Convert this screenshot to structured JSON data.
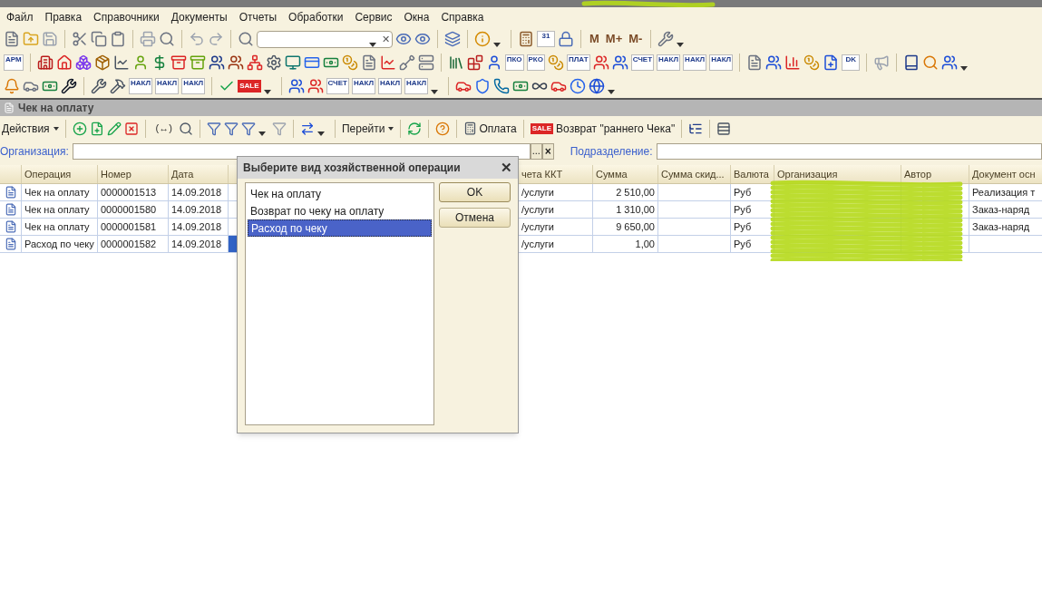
{
  "menu": [
    "Файл",
    "Правка",
    "Справочники",
    "Документы",
    "Отчеты",
    "Обработки",
    "Сервис",
    "Окна",
    "Справка"
  ],
  "toolbars": [
    {
      "items": [
        {
          "kind": "icon"
        },
        {
          "kind": "icon"
        },
        {
          "kind": "icon"
        },
        {
          "kind": "sep"
        },
        {
          "kind": "icon"
        },
        {
          "kind": "icon"
        },
        {
          "kind": "icon"
        },
        {
          "kind": "sep"
        },
        {
          "kind": "icon"
        },
        {
          "kind": "icon"
        },
        {
          "kind": "sep"
        },
        {
          "kind": "icon"
        },
        {
          "kind": "icon"
        },
        {
          "kind": "sep"
        },
        {
          "kind": "icon"
        },
        {
          "kind": "search",
          "clear": "✕"
        },
        {
          "kind": "icon"
        },
        {
          "kind": "icon"
        },
        {
          "kind": "sep"
        },
        {
          "kind": "icon"
        },
        {
          "kind": "sep"
        },
        {
          "kind": "icon"
        },
        {
          "kind": "drop"
        },
        {
          "kind": "sep"
        },
        {
          "kind": "icon"
        },
        {
          "kind": "tag",
          "label": "31"
        },
        {
          "kind": "icon"
        },
        {
          "kind": "sep"
        },
        {
          "kind": "letter",
          "label": "M"
        },
        {
          "kind": "letter",
          "label": "M+"
        },
        {
          "kind": "letter",
          "label": "M-"
        },
        {
          "kind": "sep"
        },
        {
          "kind": "icon"
        },
        {
          "kind": "drop"
        }
      ]
    },
    {
      "items": [
        {
          "kind": "tag",
          "label": "АРМ"
        },
        {
          "kind": "sep"
        },
        {
          "kind": "icon"
        },
        {
          "kind": "icon"
        },
        {
          "kind": "icon"
        },
        {
          "kind": "icon"
        },
        {
          "kind": "icon"
        },
        {
          "kind": "icon"
        },
        {
          "kind": "icon"
        },
        {
          "kind": "icon"
        },
        {
          "kind": "icon"
        },
        {
          "kind": "icon"
        },
        {
          "kind": "icon"
        },
        {
          "kind": "icon"
        },
        {
          "kind": "icon"
        },
        {
          "kind": "icon"
        },
        {
          "kind": "icon"
        },
        {
          "kind": "icon"
        },
        {
          "kind": "icon"
        },
        {
          "kind": "icon"
        },
        {
          "kind": "icon"
        },
        {
          "kind": "icon"
        },
        {
          "kind": "icon"
        },
        {
          "kind": "sep"
        },
        {
          "kind": "icon"
        },
        {
          "kind": "icon"
        },
        {
          "kind": "icon"
        },
        {
          "kind": "tag",
          "label": "ПКО"
        },
        {
          "kind": "tag",
          "label": "РКО"
        },
        {
          "kind": "icon"
        },
        {
          "kind": "tag",
          "label": "ПЛАТ"
        },
        {
          "kind": "icon"
        },
        {
          "kind": "icon"
        },
        {
          "kind": "tag",
          "label": "СЧЕТ"
        },
        {
          "kind": "tag",
          "label": "НАКЛ"
        },
        {
          "kind": "tag",
          "label": "НАКЛ"
        },
        {
          "kind": "tag",
          "label": "НАКЛ"
        },
        {
          "kind": "sep"
        },
        {
          "kind": "icon"
        },
        {
          "kind": "icon"
        },
        {
          "kind": "icon"
        },
        {
          "kind": "icon"
        },
        {
          "kind": "icon"
        },
        {
          "kind": "tag",
          "label": "DK"
        },
        {
          "kind": "sep"
        },
        {
          "kind": "icon"
        },
        {
          "kind": "sep"
        },
        {
          "kind": "icon"
        },
        {
          "kind": "icon"
        },
        {
          "kind": "icon"
        },
        {
          "kind": "drop"
        }
      ]
    },
    {
      "items": [
        {
          "kind": "icon"
        },
        {
          "kind": "icon"
        },
        {
          "kind": "icon"
        },
        {
          "kind": "icon"
        },
        {
          "kind": "sep"
        },
        {
          "kind": "icon"
        },
        {
          "kind": "icon"
        },
        {
          "kind": "tag",
          "label": "НАКЛ"
        },
        {
          "kind": "tag",
          "label": "НАКЛ"
        },
        {
          "kind": "tag",
          "label": "НАКЛ"
        },
        {
          "kind": "sep"
        },
        {
          "kind": "icon"
        },
        {
          "kind": "sale",
          "label": "SALE"
        },
        {
          "kind": "drop"
        },
        {
          "kind": "sep"
        },
        {
          "kind": "icon"
        },
        {
          "kind": "icon"
        },
        {
          "kind": "tag",
          "label": "СЧЕТ"
        },
        {
          "kind": "tag",
          "label": "НАКЛ"
        },
        {
          "kind": "tag",
          "label": "НАКЛ"
        },
        {
          "kind": "tag",
          "label": "НАКЛ"
        },
        {
          "kind": "drop"
        },
        {
          "kind": "sep"
        },
        {
          "kind": "icon"
        },
        {
          "kind": "icon"
        },
        {
          "kind": "icon"
        },
        {
          "kind": "icon"
        },
        {
          "kind": "icon"
        },
        {
          "kind": "icon"
        },
        {
          "kind": "icon"
        },
        {
          "kind": "icon"
        },
        {
          "kind": "drop"
        }
      ]
    }
  ],
  "form": {
    "title": "Чек на оплату",
    "toolbar": [
      {
        "kind": "menu",
        "label": "Действия"
      },
      {
        "kind": "sep"
      },
      {
        "kind": "icon"
      },
      {
        "kind": "icon"
      },
      {
        "kind": "icon"
      },
      {
        "kind": "icon"
      },
      {
        "kind": "sep"
      },
      {
        "kind": "text",
        "label": "(↔)"
      },
      {
        "kind": "icon"
      },
      {
        "kind": "sep"
      },
      {
        "kind": "icon"
      },
      {
        "kind": "icon"
      },
      {
        "kind": "icon"
      },
      {
        "kind": "drop"
      },
      {
        "kind": "icon"
      },
      {
        "kind": "sep"
      },
      {
        "kind": "icon"
      },
      {
        "kind": "drop"
      },
      {
        "kind": "sep"
      },
      {
        "kind": "menu",
        "label": "Перейти"
      },
      {
        "kind": "sep"
      },
      {
        "kind": "icon"
      },
      {
        "kind": "sep"
      },
      {
        "kind": "icon"
      },
      {
        "kind": "sep"
      },
      {
        "kind": "button",
        "label": "Оплата"
      },
      {
        "kind": "sep"
      },
      {
        "kind": "salebutton",
        "tag": "SALE",
        "label": "Возврат \"раннего Чека\""
      },
      {
        "kind": "sep"
      },
      {
        "kind": "icon"
      },
      {
        "kind": "sep"
      },
      {
        "kind": "icon"
      }
    ],
    "filters": [
      {
        "label": "Организация:"
      },
      {
        "label": "Подразделение:"
      }
    ],
    "ellipsis": "...",
    "clear": "×"
  },
  "table": {
    "columns": [
      "Операция",
      "Номер",
      "Дата",
      "чета ККТ",
      "Сумма",
      "Сумма скид...",
      "Валюта",
      "Организация",
      "Автор",
      "Документ осн"
    ],
    "rows": [
      {
        "selected": false,
        "cells": [
          "Чек на оплату",
          "0000001513",
          "14.09.2018",
          "/услуги",
          "2 510,00",
          "",
          "Руб",
          "",
          "",
          "Реализация т"
        ]
      },
      {
        "selected": false,
        "cells": [
          "Чек на оплату",
          "0000001580",
          "14.09.2018",
          "/услуги",
          "1 310,00",
          "",
          "Руб",
          "",
          "",
          "Заказ-наряд"
        ]
      },
      {
        "selected": false,
        "cells": [
          "Чек на оплату",
          "0000001581",
          "14.09.2018",
          "/услуги",
          "9 650,00",
          "",
          "Руб",
          "",
          "",
          "Заказ-наряд"
        ]
      },
      {
        "selected": true,
        "cells": [
          "Расход по чеку",
          "0000001582",
          "14.09.2018",
          "/услуги",
          "1,00",
          "",
          "Руб",
          "",
          "",
          ""
        ]
      }
    ]
  },
  "dialog": {
    "title": "Выберите вид хозяйственной операции",
    "close": "✕",
    "options": [
      {
        "label": "Чек на оплату",
        "selected": false
      },
      {
        "label": "Возврат по чеку на оплату",
        "selected": false
      },
      {
        "label": "Расход по чеку",
        "selected": true
      }
    ],
    "buttons": [
      "OK",
      "Отмена"
    ]
  }
}
